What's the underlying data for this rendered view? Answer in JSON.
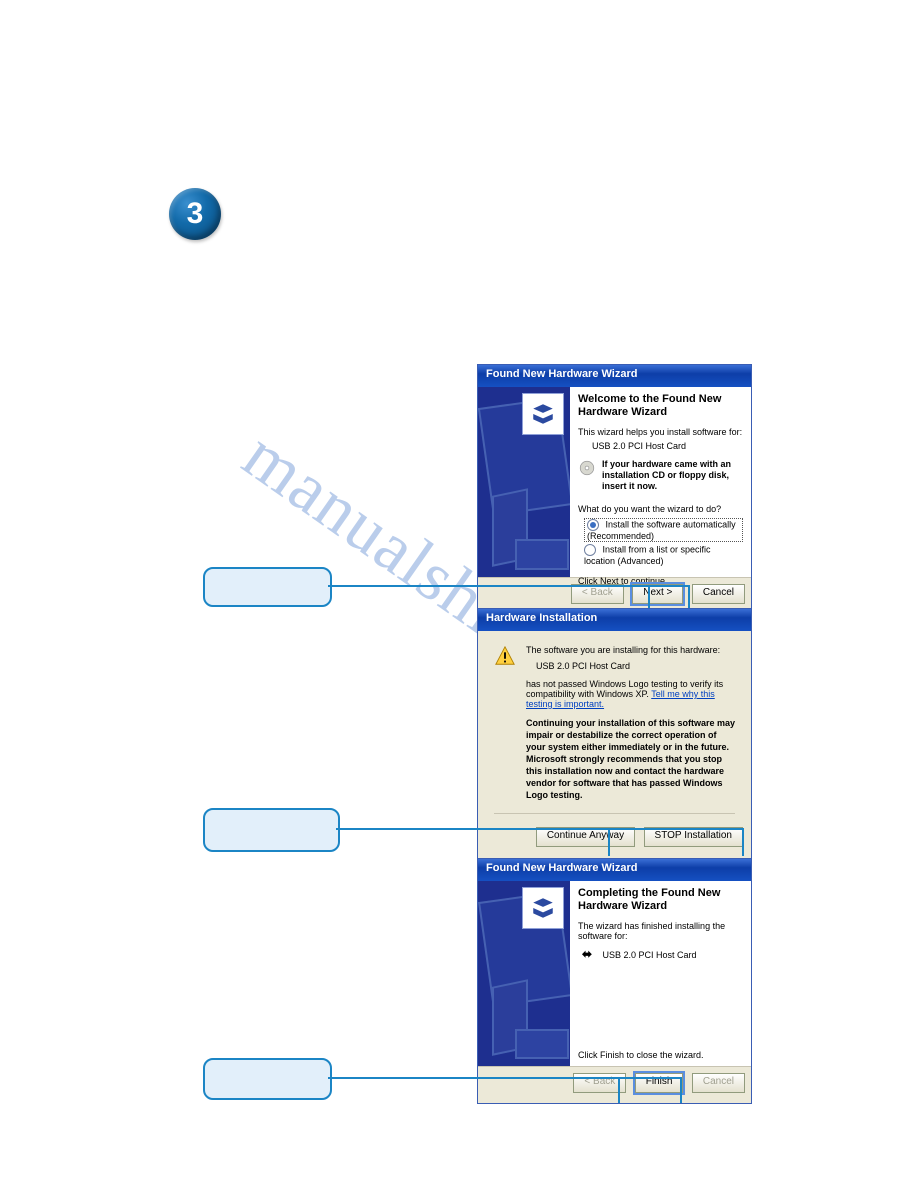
{
  "step_number": "3",
  "watermark": "manualshive.com",
  "dialog1": {
    "title": "Found New Hardware Wizard",
    "heading": "Welcome to the Found New Hardware Wizard",
    "intro": "This wizard helps you install software for:",
    "device": "USB 2.0 PCI Host Card",
    "cd_note": "If your hardware came with an installation CD or floppy disk, insert it now.",
    "question": "What do you want the wizard to do?",
    "opt1": "Install the software automatically (Recommended)",
    "opt2": "Install from a list or specific location (Advanced)",
    "footer": "Click Next to continue.",
    "back": "< Back",
    "next": "Next >",
    "cancel": "Cancel"
  },
  "dialog2": {
    "title": "Hardware Installation",
    "line1": "The software you are installing for this hardware:",
    "device": "USB 2.0 PCI Host Card",
    "line2a": "has not passed Windows Logo testing to verify its compatibility with Windows XP. ",
    "link": "Tell me why this testing is important.",
    "warn": "Continuing your installation of this software may impair or destabilize the correct operation of your system either immediately or in the future. Microsoft strongly recommends that you stop this installation now and contact the hardware vendor for software that has passed Windows Logo testing.",
    "continue": "Continue Anyway",
    "stop": "STOP Installation"
  },
  "dialog3": {
    "title": "Found New Hardware Wizard",
    "heading": "Completing the Found New Hardware Wizard",
    "intro": "The wizard has finished installing the software for:",
    "device": "USB 2.0 PCI Host Card",
    "footer": "Click Finish to close the wizard.",
    "back": "< Back",
    "finish": "Finish",
    "cancel": "Cancel"
  }
}
